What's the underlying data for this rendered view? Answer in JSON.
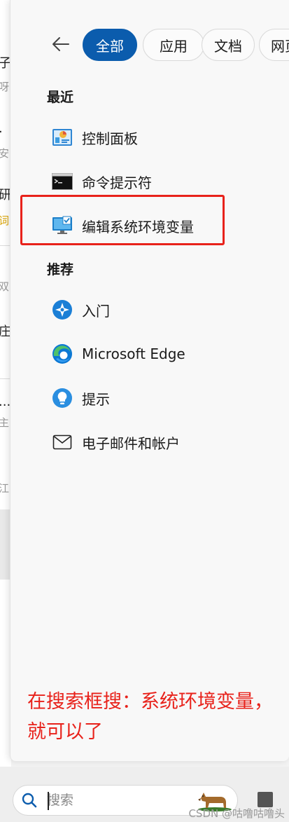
{
  "background_fragments": [
    "子.",
    "呀",
    "·",
    "安",
    "研",
    "词",
    "双",
    "庄",
    "...",
    "主",
    "江"
  ],
  "filters": {
    "all": "全部",
    "apps": "应用",
    "documents": "文档",
    "web": "网页"
  },
  "recent": {
    "title": "最近",
    "items": [
      {
        "label": "控制面板",
        "icon": "control-panel-icon"
      },
      {
        "label": "命令提示符",
        "icon": "command-prompt-icon"
      },
      {
        "label": "编辑系统环境变量",
        "icon": "system-properties-icon"
      }
    ]
  },
  "recommended": {
    "title": "推荐",
    "items": [
      {
        "label": "入门",
        "icon": "get-started-icon"
      },
      {
        "label": "Microsoft Edge",
        "icon": "edge-icon"
      },
      {
        "label": "提示",
        "icon": "tips-icon"
      },
      {
        "label": "电子邮件和帐户",
        "icon": "mail-icon"
      }
    ]
  },
  "annotation": "在搜索框搜：系统环境变量，就可以了",
  "search": {
    "placeholder": "搜索"
  },
  "watermark": "CSDN @咕噜咕噜头",
  "colors": {
    "accent": "#0b5cad",
    "annotation_red": "#e8221b"
  }
}
